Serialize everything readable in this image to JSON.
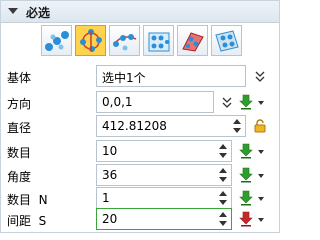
{
  "section": {
    "title": "必选"
  },
  "toolbar": {
    "buttons": [
      {
        "icon": "linear-pattern-icon",
        "active": false
      },
      {
        "icon": "circular-pattern-icon",
        "active": true
      },
      {
        "icon": "curve-pattern-icon",
        "active": false
      },
      {
        "icon": "fill-pattern-icon",
        "active": false
      },
      {
        "icon": "variable-pattern-icon",
        "active": false
      },
      {
        "icon": "mirror-pattern-icon",
        "active": false
      }
    ]
  },
  "fields": {
    "base": {
      "label": "基体",
      "value": "选中1个"
    },
    "direction": {
      "label": "方向",
      "value": "0,0,1"
    },
    "diameter": {
      "label": "直径",
      "value": "412.81208"
    },
    "count": {
      "label": "数目",
      "value": "10"
    },
    "angle": {
      "label": "角度",
      "value": "36"
    },
    "count_n": {
      "label": "数目  N",
      "value": "1"
    },
    "spacing_s": {
      "label": "间距  S",
      "value": "20"
    }
  },
  "colors": {
    "accent_active": "#ffd34d",
    "green_arrow": "#2e9e2e",
    "red_arrow": "#c62828",
    "focus_border": "#3aa53a",
    "lock": "#e0a020"
  }
}
